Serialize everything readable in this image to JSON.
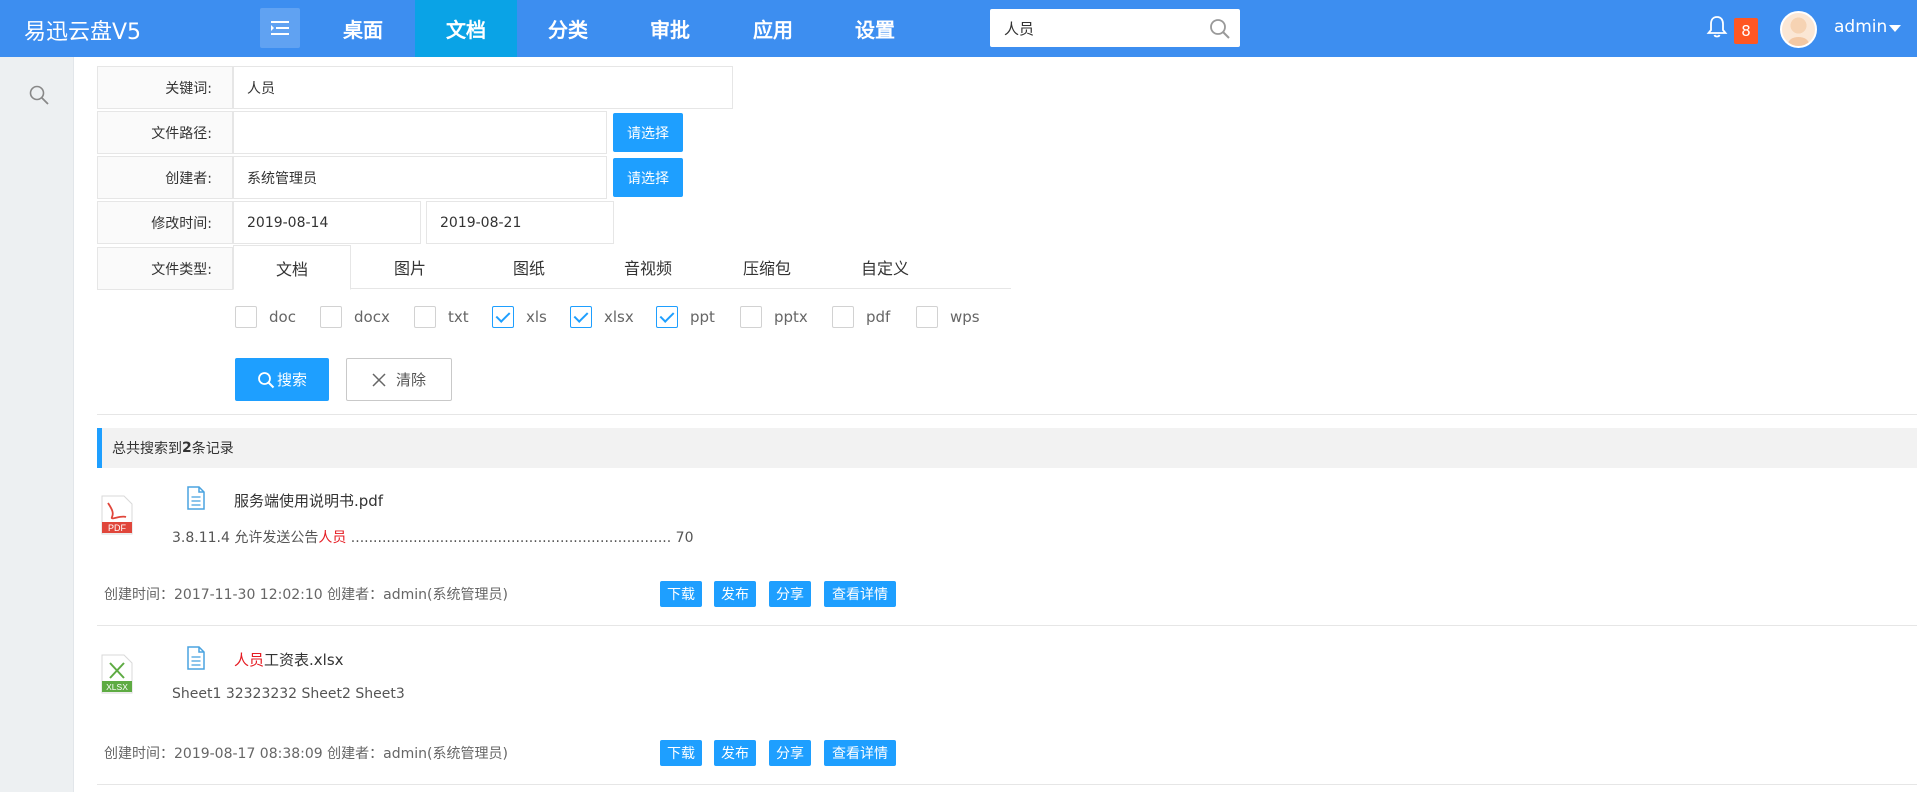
{
  "app": {
    "title": "易迅云盘V5"
  },
  "nav": {
    "items": [
      {
        "label": "桌面",
        "active": false
      },
      {
        "label": "文档",
        "active": true
      },
      {
        "label": "分类",
        "active": false
      },
      {
        "label": "审批",
        "active": false
      },
      {
        "label": "应用",
        "active": false
      },
      {
        "label": "设置",
        "active": false
      }
    ]
  },
  "top_search": {
    "value": "人员"
  },
  "notifications": {
    "count": "8"
  },
  "user": {
    "name": "admin"
  },
  "form": {
    "keyword_label": "关键词:",
    "keyword_value": "人员",
    "path_label": "文件路径:",
    "path_value": "",
    "path_button": "请选择",
    "creator_label": "创建者:",
    "creator_value": "系统管理员",
    "creator_button": "请选择",
    "mtime_label": "修改时间:",
    "mtime_from": "2019-08-14",
    "mtime_to": "2019-08-21",
    "type_label": "文件类型:",
    "type_tabs": [
      "文档",
      "图片",
      "图纸",
      "音视频",
      "压缩包",
      "自定义"
    ],
    "active_type_tab": "文档",
    "extensions": [
      {
        "label": "doc",
        "checked": false
      },
      {
        "label": "docx",
        "checked": false
      },
      {
        "label": "txt",
        "checked": false
      },
      {
        "label": "xls",
        "checked": true
      },
      {
        "label": "xlsx",
        "checked": true
      },
      {
        "label": "ppt",
        "checked": true
      },
      {
        "label": "pptx",
        "checked": false
      },
      {
        "label": "pdf",
        "checked": false
      },
      {
        "label": "wps",
        "checked": false
      }
    ],
    "search_button": "搜索",
    "clear_button": "清除"
  },
  "results": {
    "summary_prefix": "总共搜索到",
    "count": "2",
    "summary_suffix": "条记录",
    "items": [
      {
        "file_type": "PDF",
        "title_before": "",
        "title_highlight": "",
        "title_after": "服务端使用说明书.pdf",
        "snippet_before": "3.8.11.4 允许发送公告",
        "snippet_highlight": "人员",
        "snippet_after": " ........................................................................ 70",
        "meta": "创建时间：2017-11-30 12:02:10  创建者：admin(系统管理员)",
        "actions": [
          "下载",
          "发布",
          "分享",
          "查看详情"
        ]
      },
      {
        "file_type": "XLSX",
        "title_before": "",
        "title_highlight": "人员",
        "title_after": "工资表.xlsx",
        "snippet_before": "Sheet1 32323232 Sheet2 Sheet3",
        "snippet_highlight": "",
        "snippet_after": "",
        "meta": "创建时间：2019-08-17 08:38:09  创建者：admin(系统管理员)",
        "actions": [
          "下载",
          "发布",
          "分享",
          "查看详情"
        ]
      }
    ]
  },
  "colors": {
    "topbar": "#3d8ef0",
    "active_nav": "#0aa3e6",
    "primary": "#1e9fff",
    "highlight": "#e51c23",
    "badge": "#ff5722"
  }
}
